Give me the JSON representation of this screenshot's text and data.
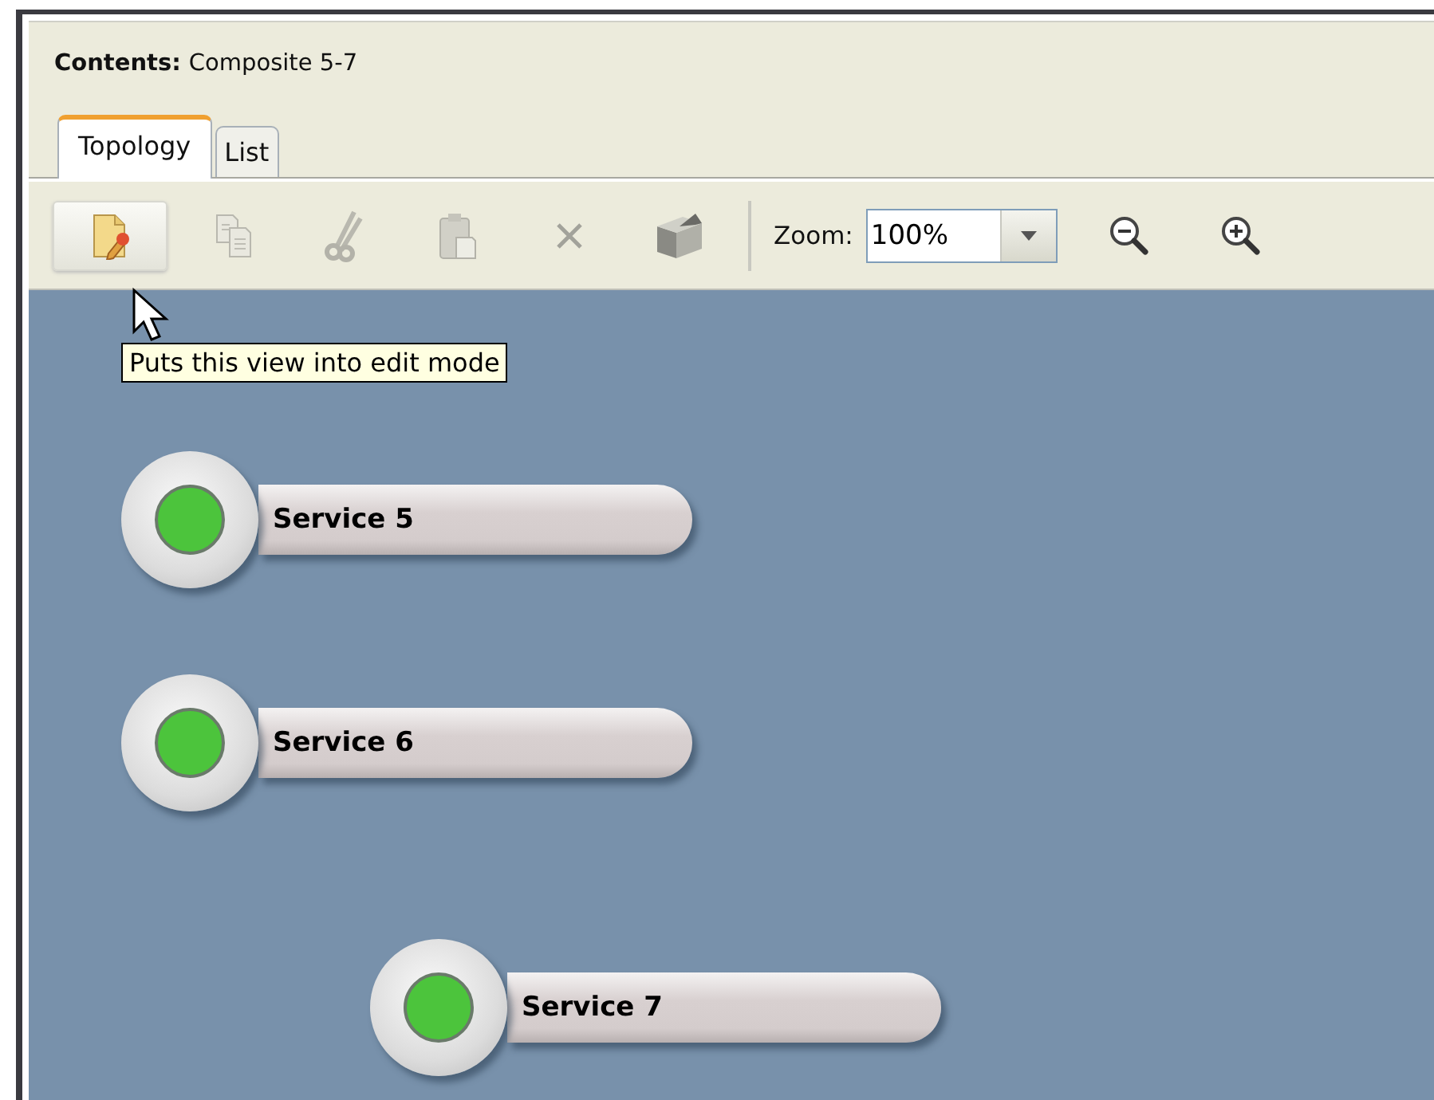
{
  "header": {
    "label": "Contents:",
    "value": "Composite 5-7"
  },
  "tabs": [
    {
      "label": "Topology",
      "selected": true
    },
    {
      "label": "List",
      "selected": false
    }
  ],
  "toolbar": {
    "tools": [
      {
        "kind": "edit",
        "disabled": false,
        "hovered": true
      },
      {
        "kind": "copy",
        "disabled": true,
        "hovered": false
      },
      {
        "kind": "cut",
        "disabled": true,
        "hovered": false
      },
      {
        "kind": "paste",
        "disabled": true,
        "hovered": false
      },
      {
        "kind": "delete",
        "disabled": true,
        "hovered": false
      },
      {
        "kind": "import",
        "disabled": false,
        "hovered": false
      }
    ],
    "zoom": {
      "label": "Zoom:",
      "value": "100%"
    },
    "zoom_buttons": [
      {
        "kind": "zoom-out"
      },
      {
        "kind": "zoom-in"
      }
    ]
  },
  "tooltip": "Puts this view into edit mode",
  "nodes": [
    {
      "label": "Service 5",
      "color": "#4cc43c"
    },
    {
      "label": "Service 6",
      "color": "#4cc43c"
    },
    {
      "label": "Service 7",
      "color": "#4cc43c"
    }
  ]
}
